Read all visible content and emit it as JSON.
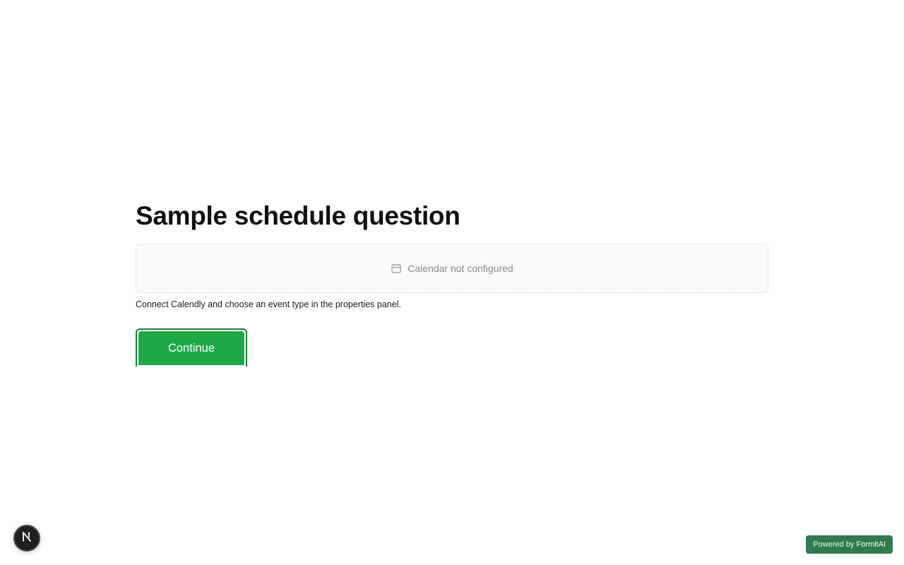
{
  "question": {
    "title": "Sample schedule question",
    "calendar_status": "Calendar not configured",
    "calendar_icon": "calendar-icon",
    "helper_text": "Connect Calendly and choose an event type in the properties panel.",
    "continue_label": "Continue"
  },
  "badge": {
    "letter_icon": "n-logo-icon"
  },
  "footer": {
    "powered_prefix": "Powered by",
    "powered_brand": "FormitAI"
  },
  "colors": {
    "accent": "#1fa84a",
    "accent_border": "#1a7f37",
    "powered_bg": "#2f7a4f"
  }
}
